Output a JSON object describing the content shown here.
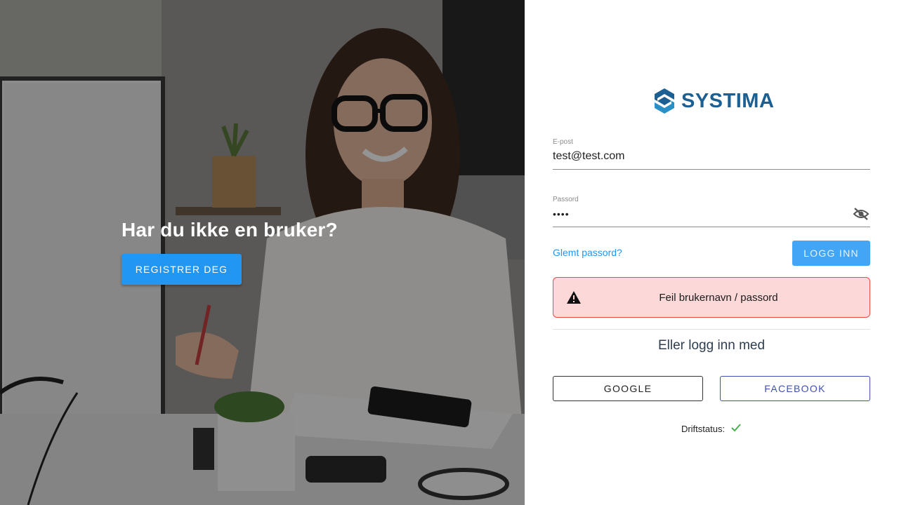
{
  "hero": {
    "title": "Har du ikke en bruker?",
    "register_label": "REGISTRER DEG",
    "image_icon": "office-woman-photo"
  },
  "logo": {
    "text": "SYSTIMA",
    "color": "#1b5f93",
    "icon": "systima-logo-icon"
  },
  "form": {
    "email_label": "E-post",
    "email_value": "test@test.com",
    "password_label": "Passord",
    "password_value": "••••",
    "visibility_icon": "eye-off-icon",
    "forgot_label": "Glemt passord?",
    "login_label": "LOGG INN"
  },
  "alert": {
    "message": "Feil brukernavn / passord",
    "icon": "warning-icon",
    "background": "#fdd8d8",
    "border": "#e84a4a"
  },
  "social": {
    "title": "Eller logg inn med",
    "google_label": "GOOGLE",
    "facebook_label": "FACEBOOK"
  },
  "status": {
    "label": "Driftstatus:",
    "icon": "check-icon",
    "ok_color": "#4caf50"
  },
  "colors": {
    "accent": "#2196f3"
  }
}
